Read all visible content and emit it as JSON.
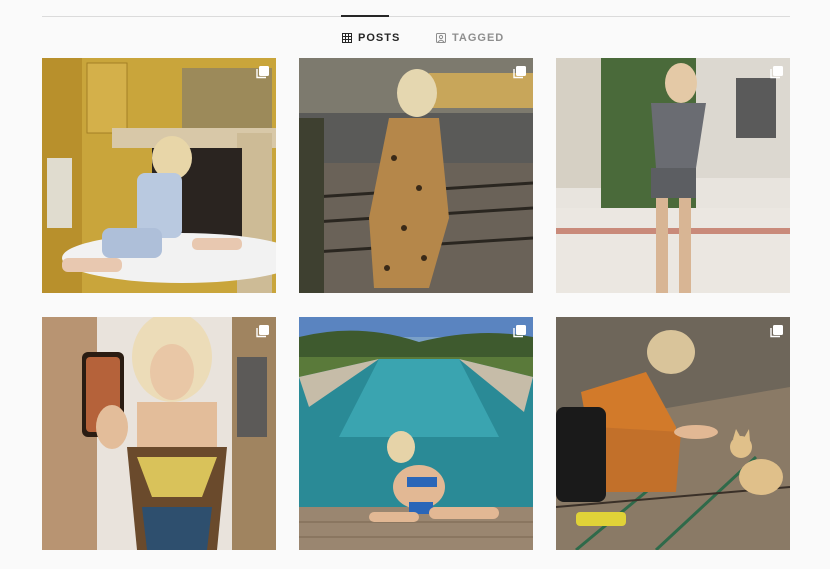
{
  "tabs": [
    {
      "label": "POSTS",
      "icon": "grid-icon",
      "active": true
    },
    {
      "label": "TAGGED",
      "icon": "tag-icon",
      "active": false
    }
  ],
  "posts": [
    {
      "alt": "",
      "icon": "carousel-icon"
    },
    {
      "alt": "",
      "icon": "carousel-icon"
    },
    {
      "alt": "",
      "icon": "carousel-icon"
    },
    {
      "alt": "",
      "icon": "carousel-icon"
    },
    {
      "alt": "",
      "icon": "carousel-icon"
    },
    {
      "alt": "",
      "icon": "carousel-icon"
    }
  ],
  "colors": {
    "background": "#fafafa",
    "divider": "#dbdbdb",
    "active_tab": "#262626",
    "inactive_tab": "#8e8e8e"
  }
}
